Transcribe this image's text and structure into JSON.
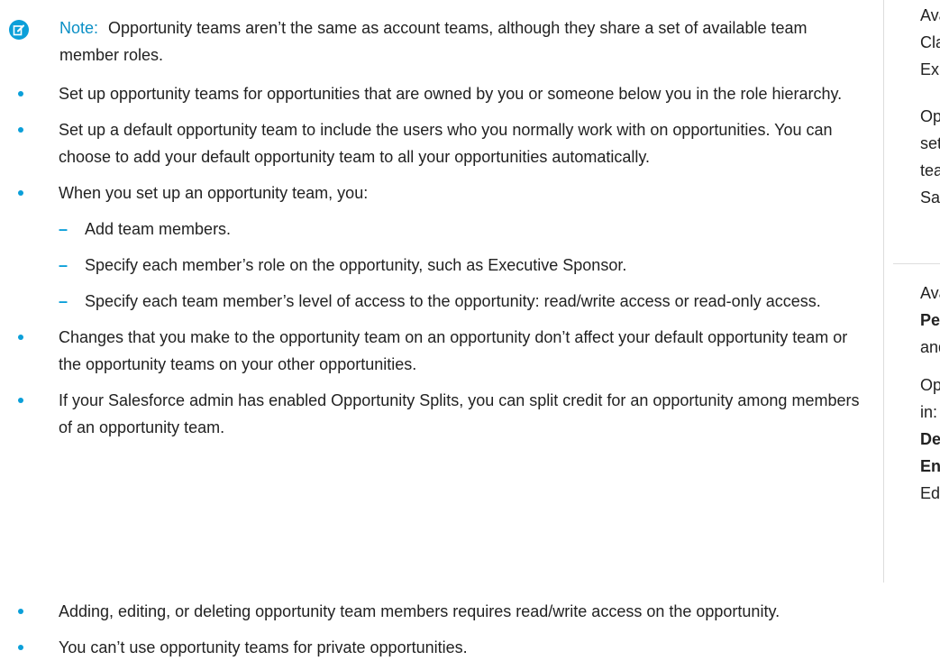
{
  "note": {
    "label": "Note:",
    "text": "Opportunity teams aren’t the same as account teams, although they share a set of available team member roles."
  },
  "bullets": [
    {
      "text": "Set up opportunity teams for opportunities that are owned by you or someone below you in the role hierarchy."
    },
    {
      "text": "Set up a default opportunity team to include the users who you normally work with on opportunities. You can choose to add your default opportunity team to all your opportunities automatically."
    },
    {
      "text": "When you set up an opportunity team, you:",
      "sub": [
        "Add team members.",
        "Specify each member’s role on the opportunity, such as Executive Sponsor.",
        "Specify each team member’s level of access to the opportunity: read/write access or read-only access."
      ]
    },
    {
      "text": "Changes that you make to the opportunity team on an opportunity don’t affect your default opportunity team or the opportunity teams on your other opportunities."
    },
    {
      "text": "If your Salesforce admin has enabled Opportunity Splits, you can split credit for an opportunity among members of an opportunity team."
    },
    {
      "text": "Adding, editing, or deleting opportunity team members requires read/write access on the opportunity."
    },
    {
      "text": "You can’t use opportunity teams for private opportunities."
    }
  ],
  "sidebar": {
    "lines1": [
      "Ava",
      "Clas",
      "Exp"
    ],
    "lines2": [
      "Opp",
      "sett",
      "tear",
      "Sale"
    ],
    "lines3": [
      "Ava",
      "Per",
      "and"
    ],
    "lines4": [
      "Opp",
      "in: I",
      "Dev",
      "Ente",
      "Edit"
    ]
  },
  "colors": {
    "accent": "#0b9fd9",
    "note_label": "#0a8fc5",
    "text": "#222222"
  },
  "icons": {
    "note": "edit-note-icon",
    "bullet": "bullet-dot",
    "sub_bullet": "dash"
  }
}
